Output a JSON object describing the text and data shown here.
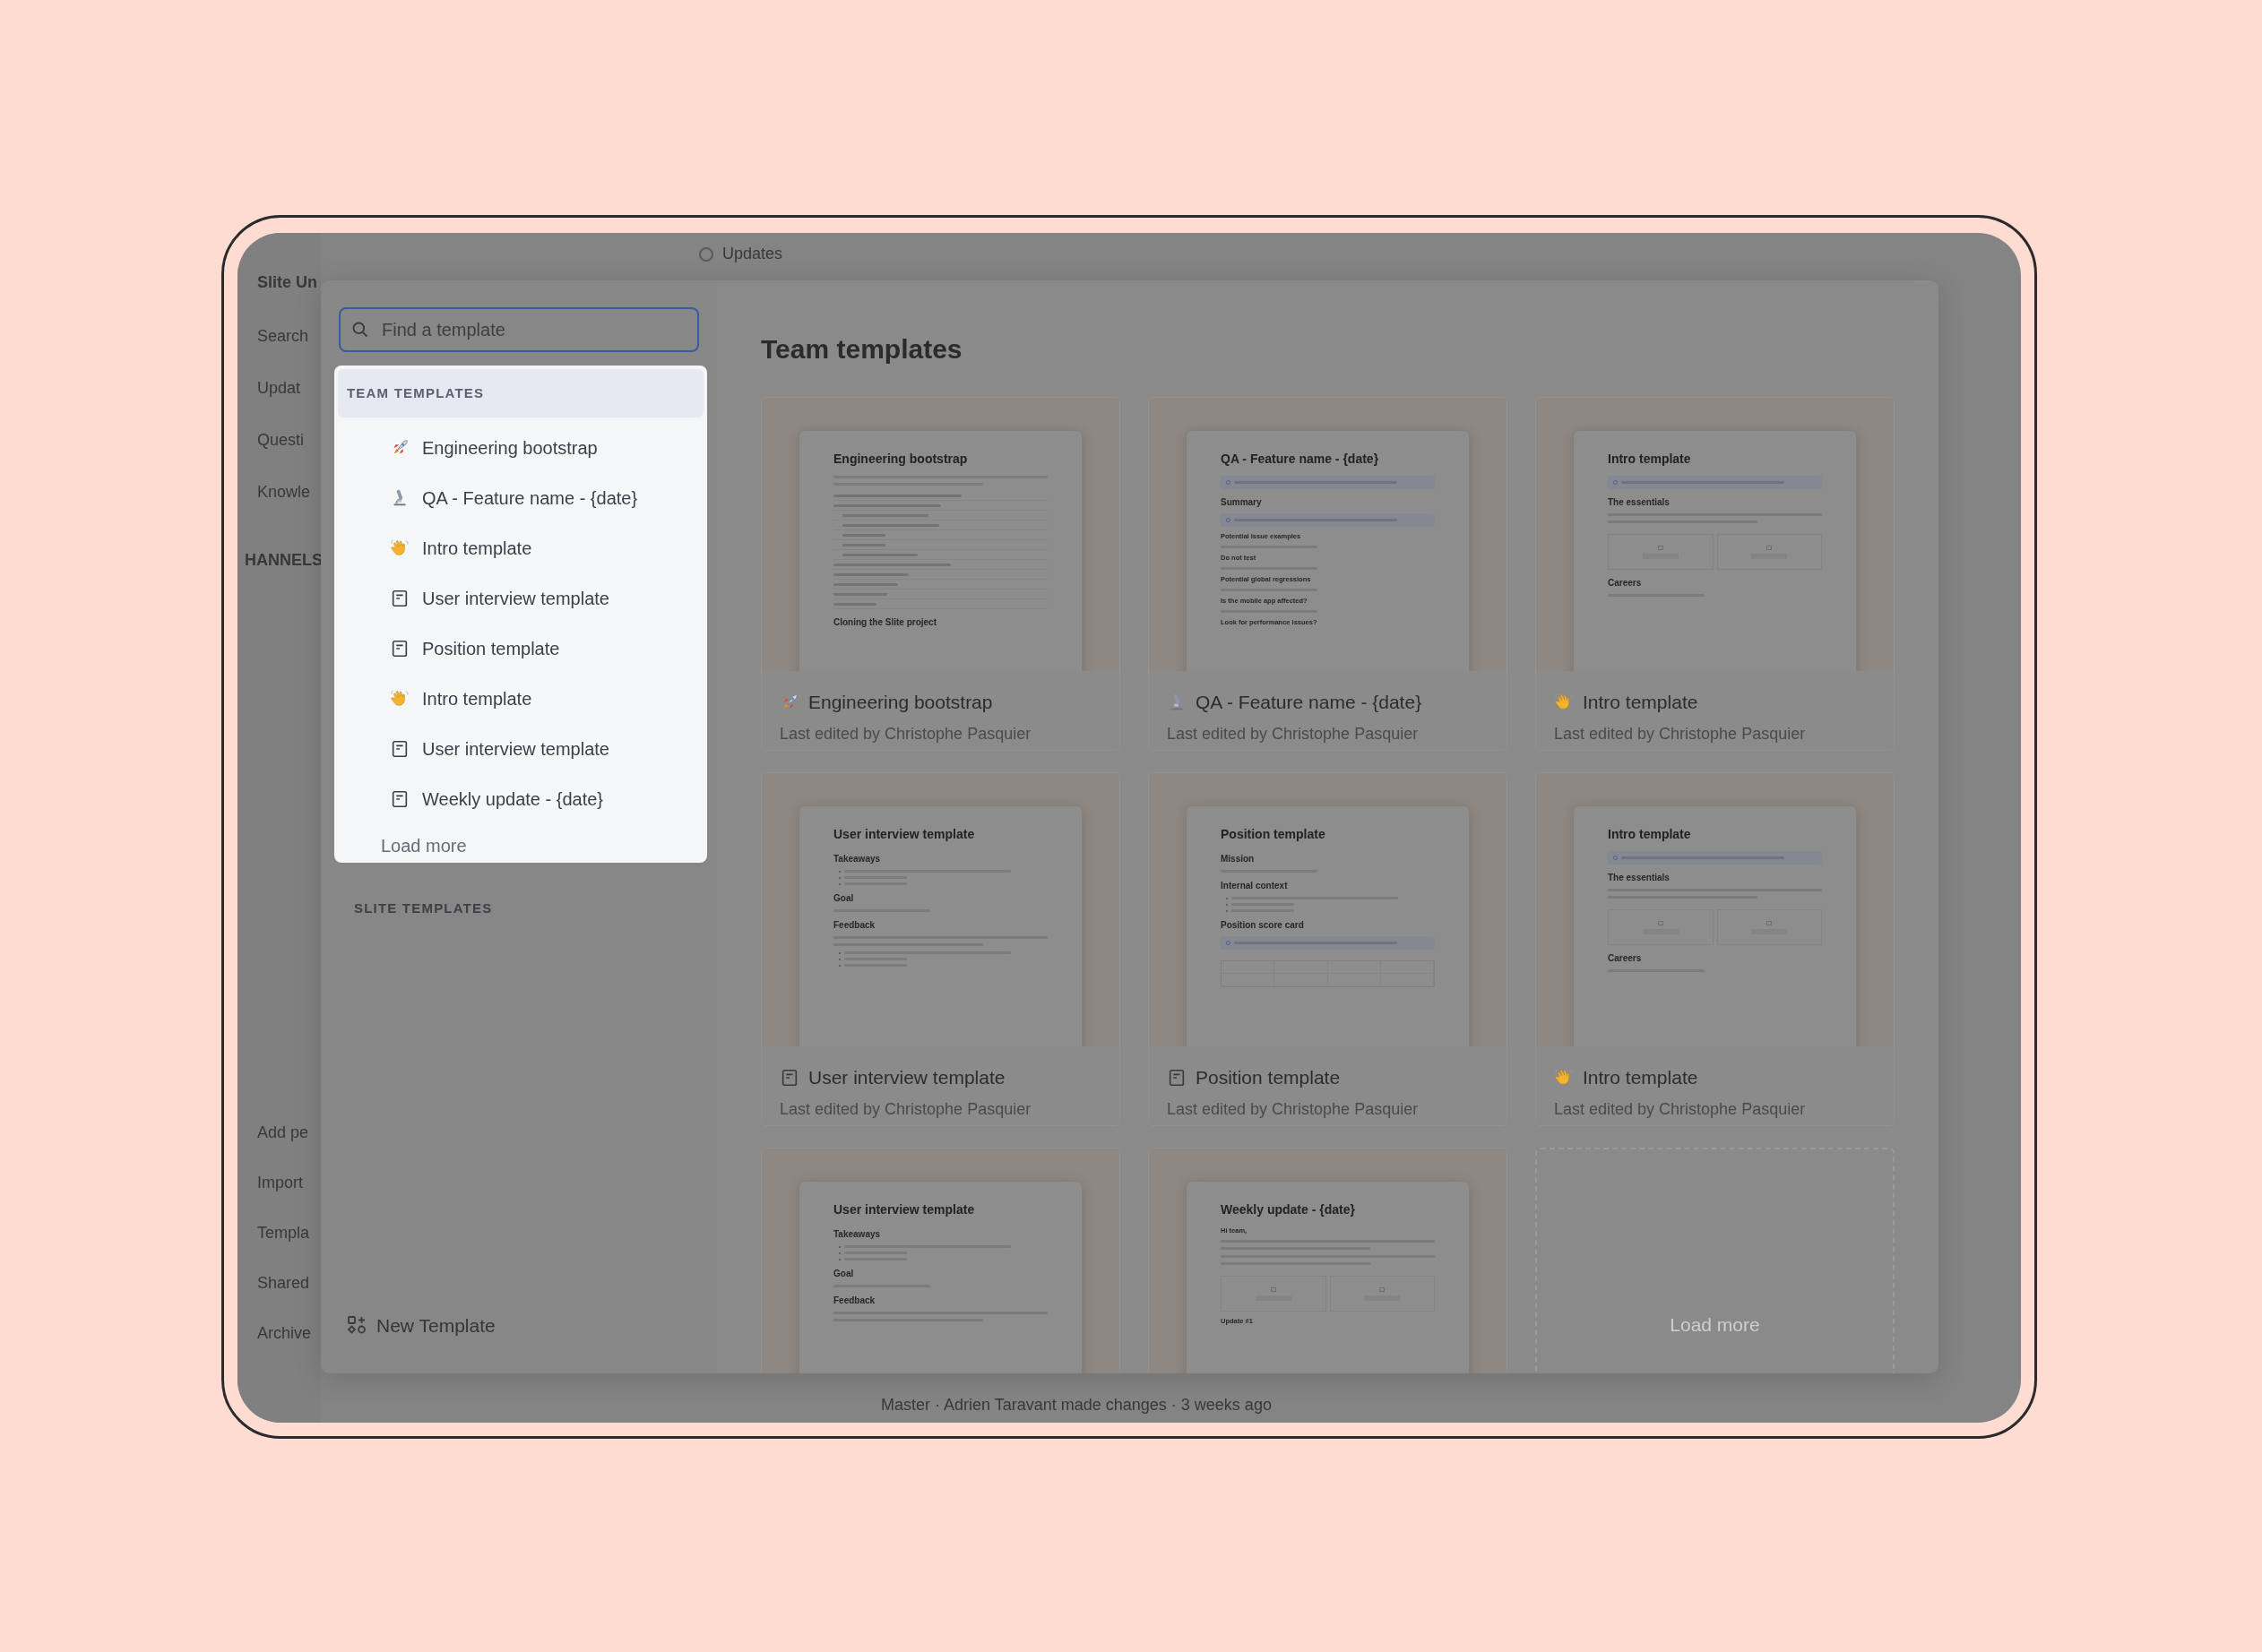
{
  "background_app": {
    "sidebar_top": [
      "Slite Un",
      "Search",
      "Updat",
      "Questi",
      "Knowle"
    ],
    "section": "HANNELS",
    "sidebar_bottom": [
      "Add pe",
      "Import",
      "Templa",
      "Shared",
      "Archive"
    ],
    "top_bar_title": "Updates",
    "status_line": "Master  ·  Adrien Taravant made changes  ·  3 weeks ago"
  },
  "template_picker": {
    "search": {
      "placeholder": "Find a template"
    },
    "dropdown": {
      "header": "TEAM TEMPLATES",
      "items": [
        {
          "kind": "rocket",
          "label": "Engineering bootstrap"
        },
        {
          "kind": "microscope",
          "label": "QA - Feature name - {date}"
        },
        {
          "kind": "wave",
          "label": "Intro template"
        },
        {
          "kind": "doc",
          "label": "User interview template"
        },
        {
          "kind": "doc",
          "label": "Position template"
        },
        {
          "kind": "wave",
          "label": "Intro template"
        },
        {
          "kind": "doc",
          "label": "User interview template"
        },
        {
          "kind": "doc",
          "label": "Weekly update - {date}"
        }
      ],
      "load_more": "Load more"
    },
    "slite_section": "SLITE TEMPLATES",
    "new_template": "New Template",
    "heading": "Team templates",
    "cards": [
      {
        "kind": "rocket",
        "title": "Engineering bootstrap",
        "subtitle": "Last edited by Christophe Pasquier",
        "preview": {
          "title": "Engineering bootstrap",
          "blocks": [
            {
              "kind": "lines"
            },
            {
              "kind": "toc"
            },
            {
              "kind": "heading",
              "text": "Cloning the Slite project"
            }
          ]
        }
      },
      {
        "kind": "microscope",
        "title": "QA - Feature name - {date}",
        "subtitle": "Last edited by Christophe Pasquier",
        "preview": {
          "title": "QA - Feature name - {date}",
          "blocks": [
            {
              "kind": "callout"
            },
            {
              "kind": "heading",
              "text": "Summary"
            },
            {
              "kind": "callout"
            },
            {
              "kind": "label",
              "text": "Potential issue examples"
            },
            {
              "kind": "dash"
            },
            {
              "kind": "label",
              "text": "Do not test"
            },
            {
              "kind": "dash"
            },
            {
              "kind": "label",
              "text": "Potential global regressions"
            },
            {
              "kind": "dash"
            },
            {
              "kind": "label",
              "text": "Is the mobile app affected?"
            },
            {
              "kind": "dash"
            },
            {
              "kind": "label",
              "text": "Look for performance issues?"
            }
          ]
        }
      },
      {
        "kind": "wave",
        "title": "Intro template",
        "subtitle": "Last edited by Christophe Pasquier",
        "preview": {
          "title": "Intro template",
          "blocks": [
            {
              "kind": "callout"
            },
            {
              "kind": "heading",
              "text": "The essentials"
            },
            {
              "kind": "lines"
            },
            {
              "kind": "images"
            },
            {
              "kind": "heading",
              "text": "Careers"
            },
            {
              "kind": "dash"
            }
          ]
        }
      },
      {
        "kind": "doc",
        "title": "User interview template",
        "subtitle": "Last edited by Christophe Pasquier",
        "preview": {
          "title": "User interview template",
          "blocks": [
            {
              "kind": "heading",
              "text": "Takeaways"
            },
            {
              "kind": "bullets"
            },
            {
              "kind": "heading",
              "text": "Goal"
            },
            {
              "kind": "dash"
            },
            {
              "kind": "heading",
              "text": "Feedback"
            },
            {
              "kind": "lines"
            },
            {
              "kind": "bullets"
            }
          ]
        }
      },
      {
        "kind": "doc",
        "title": "Position template",
        "subtitle": "Last edited by Christophe Pasquier",
        "preview": {
          "title": "Position template",
          "blocks": [
            {
              "kind": "heading",
              "text": "Mission"
            },
            {
              "kind": "dash"
            },
            {
              "kind": "heading",
              "text": "Internal context"
            },
            {
              "kind": "bullets"
            },
            {
              "kind": "heading",
              "text": "Position score card"
            },
            {
              "kind": "callout"
            },
            {
              "kind": "table"
            }
          ]
        }
      },
      {
        "kind": "wave",
        "title": "Intro template",
        "subtitle": "Last edited by Christophe Pasquier",
        "preview": {
          "title": "Intro template",
          "blocks": [
            {
              "kind": "callout"
            },
            {
              "kind": "heading",
              "text": "The essentials"
            },
            {
              "kind": "lines"
            },
            {
              "kind": "images"
            },
            {
              "kind": "heading",
              "text": "Careers"
            },
            {
              "kind": "dash"
            }
          ]
        }
      },
      {
        "preview": {
          "title": "User interview template",
          "blocks": [
            {
              "kind": "heading",
              "text": "Takeaways"
            },
            {
              "kind": "bullets"
            },
            {
              "kind": "heading",
              "text": "Goal"
            },
            {
              "kind": "dash"
            },
            {
              "kind": "heading",
              "text": "Feedback"
            },
            {
              "kind": "lines"
            }
          ]
        }
      },
      {
        "preview": {
          "title": "Weekly update - {date}",
          "blocks": [
            {
              "kind": "label",
              "text": "Hi team,"
            },
            {
              "kind": "lines"
            },
            {
              "kind": "lines"
            },
            {
              "kind": "images"
            },
            {
              "kind": "label",
              "text": "Update #1"
            }
          ]
        }
      }
    ],
    "load_more_card": "Load more"
  }
}
